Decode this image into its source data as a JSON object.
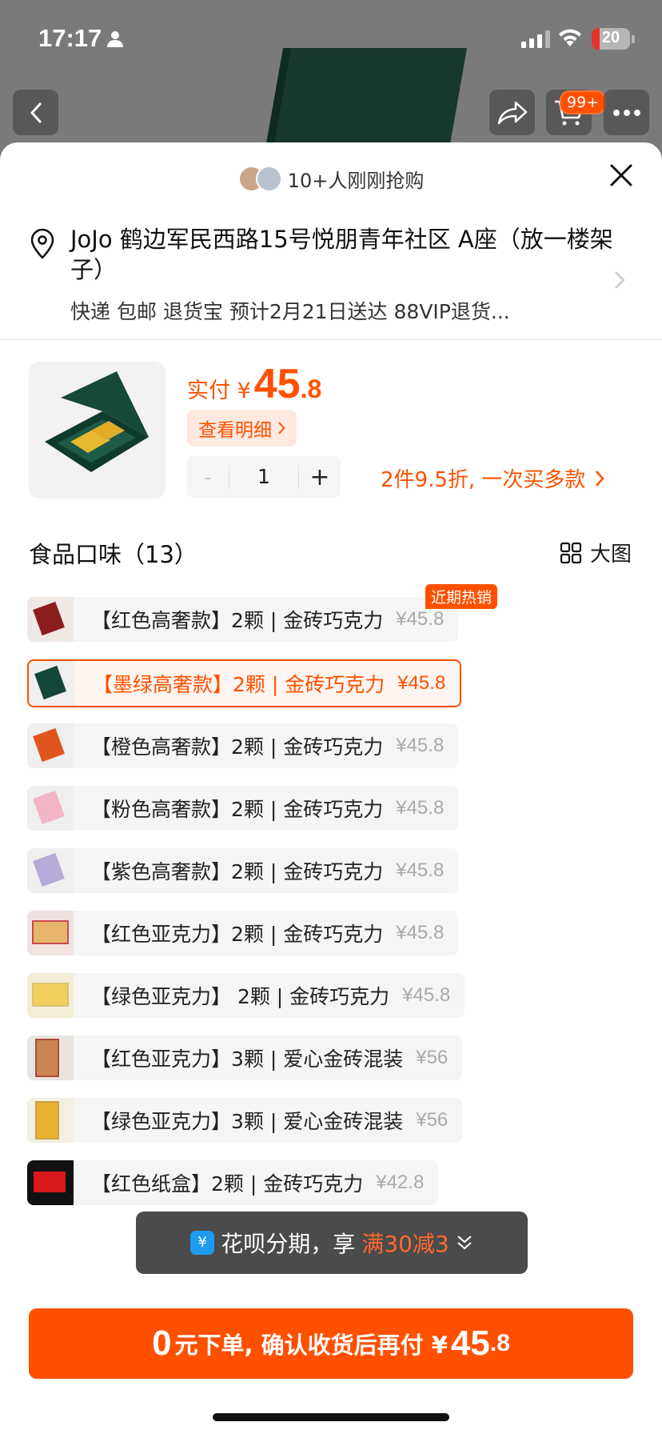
{
  "status_bar": {
    "time": "17:17",
    "battery": "20"
  },
  "nav": {
    "cart_badge": "99+"
  },
  "sheet": {
    "buyers_text": "10+人刚刚抢购",
    "address": {
      "line1": "JoJo 鹤边军民西路15号悦朋青年社区 A座（放一楼架子）",
      "line2": "快递 包邮 退货宝 预计2月21日送达 88VIP退货..."
    },
    "price": {
      "label": "实付 ¥",
      "integer": "45",
      "decimal": ".8"
    },
    "detail_label": "查看明细",
    "quantity": {
      "minus": "-",
      "value": "1",
      "plus": "+"
    },
    "promo_text": "2件9.5折, 一次买多款",
    "section": {
      "title": "食品口味（13）",
      "view_label": "大图"
    },
    "hot_tag": "近期热销",
    "variants": [
      {
        "name": "【红色高奢款】2颗 | 金砖巧克力",
        "price": "¥45.8"
      },
      {
        "name": "【墨绿高奢款】2颗 | 金砖巧克力",
        "price": "¥45.8"
      },
      {
        "name": "【橙色高奢款】2颗 | 金砖巧克力",
        "price": "¥45.8"
      },
      {
        "name": "【粉色高奢款】2颗 | 金砖巧克力",
        "price": "¥45.8"
      },
      {
        "name": "【紫色高奢款】2颗 | 金砖巧克力",
        "price": "¥45.8"
      },
      {
        "name": "【红色亚克力】2颗 | 金砖巧克力",
        "price": "¥45.8"
      },
      {
        "name": "【绿色亚克力】 2颗 | 金砖巧克力",
        "price": "¥45.8"
      },
      {
        "name": "【红色亚克力】3颗 | 爱心金砖混装",
        "price": "¥56"
      },
      {
        "name": "【绿色亚克力】3颗 | 爱心金砖混装",
        "price": "¥56"
      },
      {
        "name": "【红色纸盒】2颗 | 金砖巧克力",
        "price": "¥42.8"
      }
    ],
    "pay_toast": {
      "icon": "¥",
      "prefix": "花呗分期，享",
      "highlight": "满30减3"
    },
    "cta": {
      "zero": "0",
      "text": "元下单, 确认收货后再付 ¥",
      "amount": "45",
      "decimal": ".8"
    }
  },
  "colors": {
    "accent": "#ff5000",
    "selected_bg": "#fff5f0"
  }
}
